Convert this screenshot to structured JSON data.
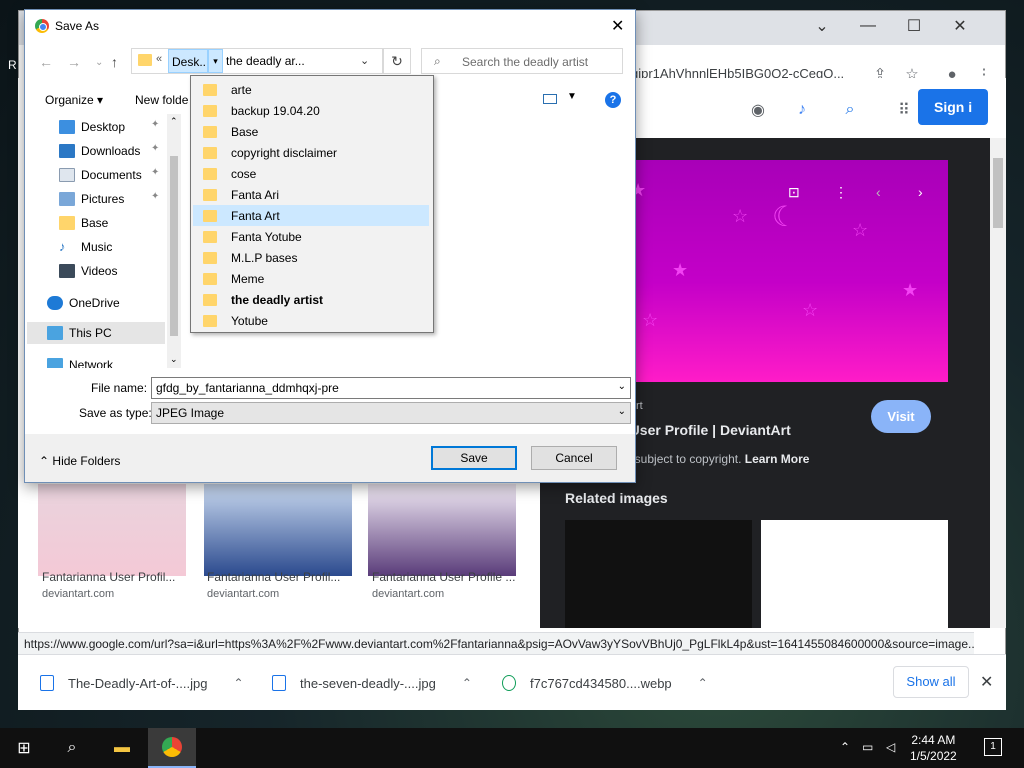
{
  "browser": {
    "url_fragment": "gjpr1AhVhnnlEHb5IBG0Q2-cCegQ...",
    "signin_label": "Sign i",
    "status_url": "https://www.google.com/url?sa=i&url=https%3A%2F%2Fwww.deviantart.com%2Ffantarianna&psig=AOvVaw3yYSovVBhUj0_PgLFlkL4p&ust=1641455084600000&source=image...",
    "results": [
      {
        "title": "Fantarianna User Profil...",
        "site": "deviantart.com"
      },
      {
        "title": "Fantarianna User Profil...",
        "site": "deviantart.com"
      },
      {
        "title": "Fantarianna User Profile ...",
        "site": "deviantart.com"
      }
    ],
    "preview": {
      "title": "a User Profile | DeviantArt",
      "copyright_text": "be subject to copyright.",
      "learn_more": "Learn More",
      "visit_label": "Visit",
      "source_tag": "rt",
      "related_heading": "Related images"
    },
    "downloads": [
      {
        "name": "The-Deadly-Art-of-....jpg"
      },
      {
        "name": "the-seven-deadly-....jpg"
      },
      {
        "name": "f7c767cd434580....webp"
      }
    ],
    "show_all_label": "Show all"
  },
  "dialog": {
    "title": "Save As",
    "address": {
      "overflow": "«",
      "segment1": "Desk...",
      "segment2": "the deadly ar..."
    },
    "search_placeholder": "Search the deadly artist",
    "organize_label": "Organize ▾",
    "new_folder_label": "New folde",
    "nav_items": [
      {
        "label": "Desktop",
        "pinned": true
      },
      {
        "label": "Downloads",
        "pinned": true
      },
      {
        "label": "Documents",
        "pinned": true
      },
      {
        "label": "Pictures",
        "pinned": true
      },
      {
        "label": "Base",
        "pinned": false
      },
      {
        "label": "Music",
        "pinned": false
      },
      {
        "label": "Videos",
        "pinned": false
      },
      {
        "label": "OneDrive",
        "pinned": false
      },
      {
        "label": "This PC",
        "pinned": false
      },
      {
        "label": "Network",
        "pinned": false
      }
    ],
    "folder_dropdown": [
      "arte",
      "backup 19.04.20",
      "Base",
      "copyright disclaimer",
      "cose",
      "Fanta Ari",
      "Fanta Art",
      "Fanta Yotube",
      "M.L.P bases",
      "Meme",
      "the deadly artist",
      "Yotube"
    ],
    "selected_folder": "Fanta Art",
    "current_folder": "the deadly artist",
    "file_name_label": "File name:",
    "file_name_value": "gfdg_by_fantarianna_ddmhqxj-pre",
    "save_type_label": "Save as type:",
    "save_type_value": "JPEG Image",
    "hide_folders_label": "Hide Folders",
    "save_label": "Save",
    "cancel_label": "Cancel"
  },
  "taskbar": {
    "time": "2:44 AM",
    "date": "1/5/2022",
    "notification_count": "1"
  },
  "colors": {
    "accent": "#0078d7",
    "google_blue": "#1a73e8",
    "preview_magenta": "#c400c8"
  }
}
